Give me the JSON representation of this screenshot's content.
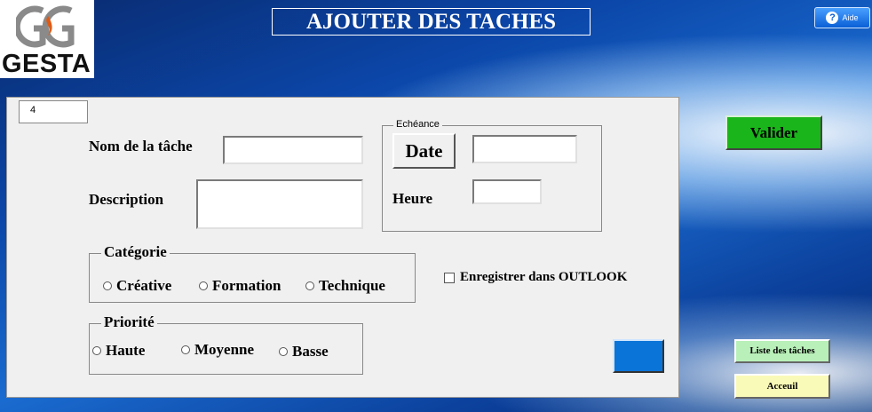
{
  "logo": {
    "brand": "GESTA"
  },
  "header": {
    "title": "AJOUTER DES TACHES",
    "help_label": "Aide",
    "help_icon": "?"
  },
  "form": {
    "id_value": "4",
    "nom_label": "Nom de la tâche",
    "nom_value": "",
    "description_label": "Description",
    "description_value": "",
    "echeance": {
      "legend": "Echéance",
      "date_button": "Date",
      "date_value": "",
      "heure_label": "Heure",
      "heure_value": ""
    },
    "categorie": {
      "legend": "Catégorie",
      "options": [
        "Créative",
        "Formation",
        "Technique"
      ],
      "selected": null
    },
    "priorite": {
      "legend": "Priorité",
      "options": [
        "Haute",
        "Moyenne",
        "Basse"
      ],
      "selected": null
    },
    "outlook_label": "Enregistrer dans OUTLOOK",
    "outlook_checked": false
  },
  "side": {
    "valider_label": "Valider",
    "liste_label": "Liste des tâches",
    "accueil_label": "Acceuil"
  },
  "colors": {
    "valider": "#1ab51a",
    "liste": "#b9f0b9",
    "accueil": "#fafab8",
    "blue_button": "#0a74d9"
  }
}
